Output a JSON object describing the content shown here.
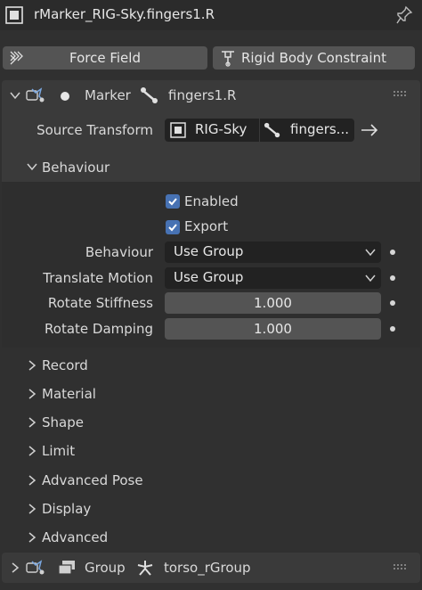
{
  "header": {
    "title": "rMarker_RIG-Sky.fingers1.R",
    "icons": [
      "object-icon",
      "pin-icon"
    ]
  },
  "top_buttons": [
    {
      "label": "Force Field",
      "icon": "force-field-icon"
    },
    {
      "label": "Rigid Body Constraint",
      "icon": "rigid-body-constraint-icon"
    }
  ],
  "marker_panel": {
    "type_label": "Marker",
    "target_label": "fingers1.R",
    "source_transform": {
      "label": "Source Transform",
      "armature": "RIG-Sky",
      "bone": "fingers..."
    },
    "behaviour_section": {
      "title": "Behaviour",
      "enabled": {
        "label": "Enabled",
        "checked": true
      },
      "export": {
        "label": "Export",
        "checked": true
      },
      "behaviour": {
        "label": "Behaviour",
        "value": "Use Group"
      },
      "translate_motion": {
        "label": "Translate Motion",
        "value": "Use Group"
      },
      "rotate_stiffness": {
        "label": "Rotate Stiffness",
        "value": "1.000"
      },
      "rotate_damping": {
        "label": "Rotate Damping",
        "value": "1.000"
      }
    },
    "collapsed_sections": [
      "Record",
      "Material",
      "Shape",
      "Limit",
      "Advanced Pose",
      "Display",
      "Advanced"
    ]
  },
  "group_panel": {
    "type_label": "Group",
    "target_label": "torso_rGroup"
  },
  "colors": {
    "background": "#303030",
    "panel": "#3a3a3a",
    "field": "#545454",
    "checkbox": "#4772b3"
  }
}
